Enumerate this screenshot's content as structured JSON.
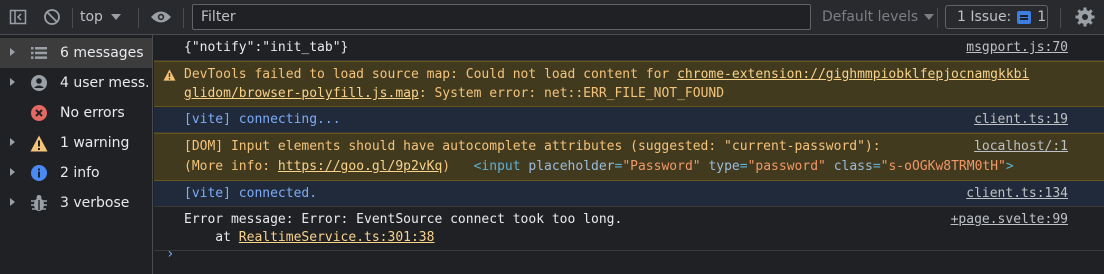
{
  "toolbar": {
    "context": "top",
    "filter_placeholder": "Filter",
    "levels": "Default levels",
    "issues_label": "1 Issue:",
    "issues_count": "1"
  },
  "sidebar": {
    "items": [
      {
        "label": "6 messages",
        "icon": "list-icon"
      },
      {
        "label": "4 user mess...",
        "icon": "user-icon"
      },
      {
        "label": "No errors",
        "icon": "error-icon"
      },
      {
        "label": "1 warning",
        "icon": "warning-icon"
      },
      {
        "label": "2 info",
        "icon": "info-icon"
      },
      {
        "label": "3 verbose",
        "icon": "bug-icon"
      }
    ]
  },
  "messages": {
    "m1": {
      "text": "{\"notify\":\"init_tab\"}",
      "source": "msgport.js:70"
    },
    "m2": {
      "prefix": "DevTools failed to load source map: Could not load content for ",
      "url1": "chrome-extension://gighmmpiobklfepjocnamgkkbi",
      "url2": "glidom/browser-polyfill.js.map",
      "suffix": ": System error: net::ERR_FILE_NOT_FOUND"
    },
    "m3": {
      "text": "[vite] connecting...",
      "source": "client.ts:19"
    },
    "m4": {
      "line1": "[DOM] Input elements should have autocomplete attributes (suggested: \"current-password\"):",
      "line2_prefix": "(More info: ",
      "link": "https://goo.gl/9p2vKq",
      "line2_suffix": ")",
      "el_open": "<input",
      "attr1": "placeholder",
      "val1": "\"Password\"",
      "attr2": "type",
      "val2": "\"password\"",
      "attr3": "class",
      "val3": "\"s-oOGKw8TRM0tH\"",
      "el_close": ">",
      "source": "localhost/:1"
    },
    "m5": {
      "text": "[vite] connected.",
      "source": "client.ts:134"
    },
    "m6": {
      "line1": "Error message: Error: EventSource connect took too long.",
      "line2_prefix": "    at ",
      "link": "RealtimeService.ts:301:38",
      "source": "+page.svelte:99"
    }
  },
  "colors": {
    "warning": "#f4c37a",
    "info": "#7cacf8",
    "error": "#e46962"
  }
}
